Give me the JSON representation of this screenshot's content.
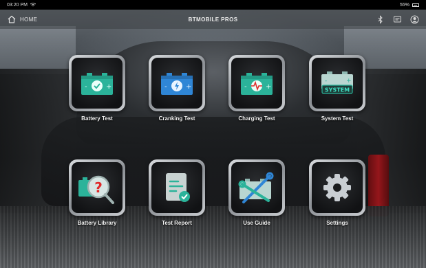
{
  "status_bar": {
    "time": "03:20 PM",
    "battery_percent": "55%"
  },
  "nav": {
    "home_label": "HOME",
    "title": "BTMOBILE PROS"
  },
  "tiles": [
    {
      "label": "Battery Test",
      "icon": "battery-check-icon"
    },
    {
      "label": "Cranking Test",
      "icon": "battery-lightning-icon"
    },
    {
      "label": "Charging Test",
      "icon": "battery-pulse-icon"
    },
    {
      "label": "System Test",
      "icon": "battery-system-icon",
      "icon_text": "SYSTEM"
    },
    {
      "label": "Battery Library",
      "icon": "battery-magnifier-icon"
    },
    {
      "label": "Test Report",
      "icon": "report-icon"
    },
    {
      "label": "Use Guide",
      "icon": "battery-tools-icon"
    },
    {
      "label": "Settings",
      "icon": "gear-icon"
    }
  ],
  "colors": {
    "battery_teal": "#2bb39a",
    "battery_blue": "#2f86d6",
    "accent_red": "#e02a2a"
  }
}
